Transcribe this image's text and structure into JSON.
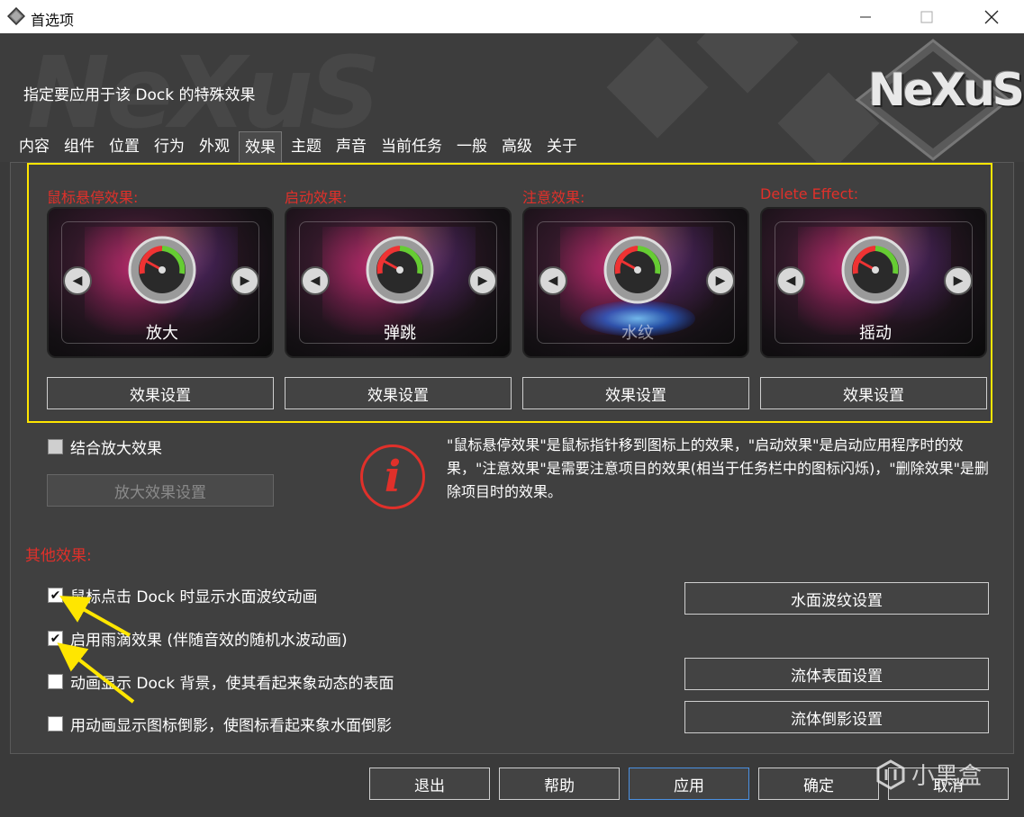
{
  "window": {
    "title": "首选项"
  },
  "header": {
    "description": "指定要应用于该 Dock 的特殊效果",
    "logo_text": "NeXuS",
    "watermark_text": "NeXuS"
  },
  "tabs": [
    {
      "label": "内容"
    },
    {
      "label": "组件"
    },
    {
      "label": "位置"
    },
    {
      "label": "行为"
    },
    {
      "label": "外观"
    },
    {
      "label": "效果",
      "active": true
    },
    {
      "label": "主题"
    },
    {
      "label": "声音"
    },
    {
      "label": "当前任务"
    },
    {
      "label": "一般"
    },
    {
      "label": "高级"
    },
    {
      "label": "关于"
    }
  ],
  "effects": [
    {
      "label": "鼠标悬停效果:",
      "preview": "放大",
      "settings_label": "效果设置"
    },
    {
      "label": "启动效果:",
      "preview": "弹跳",
      "settings_label": "效果设置"
    },
    {
      "label": "注意效果:",
      "preview": "水纹",
      "settings_label": "效果设置"
    },
    {
      "label": "Delete Effect:",
      "preview": "摇动",
      "settings_label": "效果设置"
    }
  ],
  "combine": {
    "label": "结合放大效果",
    "checked": false,
    "settings_label": "放大效果设置"
  },
  "info": {
    "text": "\"鼠标悬停效果\"是鼠标指针移到图标上的效果，\"启动效果\"是启动应用程序时的效果，\"注意效果\"是需要注意项目的效果(相当于任务栏中的图标闪烁)，\"删除效果\"是删除项目时的效果。"
  },
  "other": {
    "title": "其他效果:",
    "options": [
      {
        "label": "鼠标点击 Dock 时显示水面波纹动画",
        "checked": true
      },
      {
        "label": "启用雨滴效果 (伴随音效的随机水波动画)",
        "checked": true
      },
      {
        "label": "动画显示 Dock 背景，使其看起来象动态的表面",
        "checked": false
      },
      {
        "label": "用动画显示图标倒影，使图标看起来象水面倒影",
        "checked": false
      }
    ],
    "buttons": {
      "ripple": "水面波纹设置",
      "fluid_surface": "流体表面设置",
      "fluid_reflection": "流体倒影设置"
    }
  },
  "footer": {
    "exit": "退出",
    "help": "帮助",
    "apply": "应用",
    "ok": "确定",
    "cancel": "取消"
  },
  "watermark_brand": "小黑盒",
  "colors": {
    "accent_red": "#e0302a",
    "highlight_yellow": "#ffe600",
    "background": "#3a3a3a"
  }
}
